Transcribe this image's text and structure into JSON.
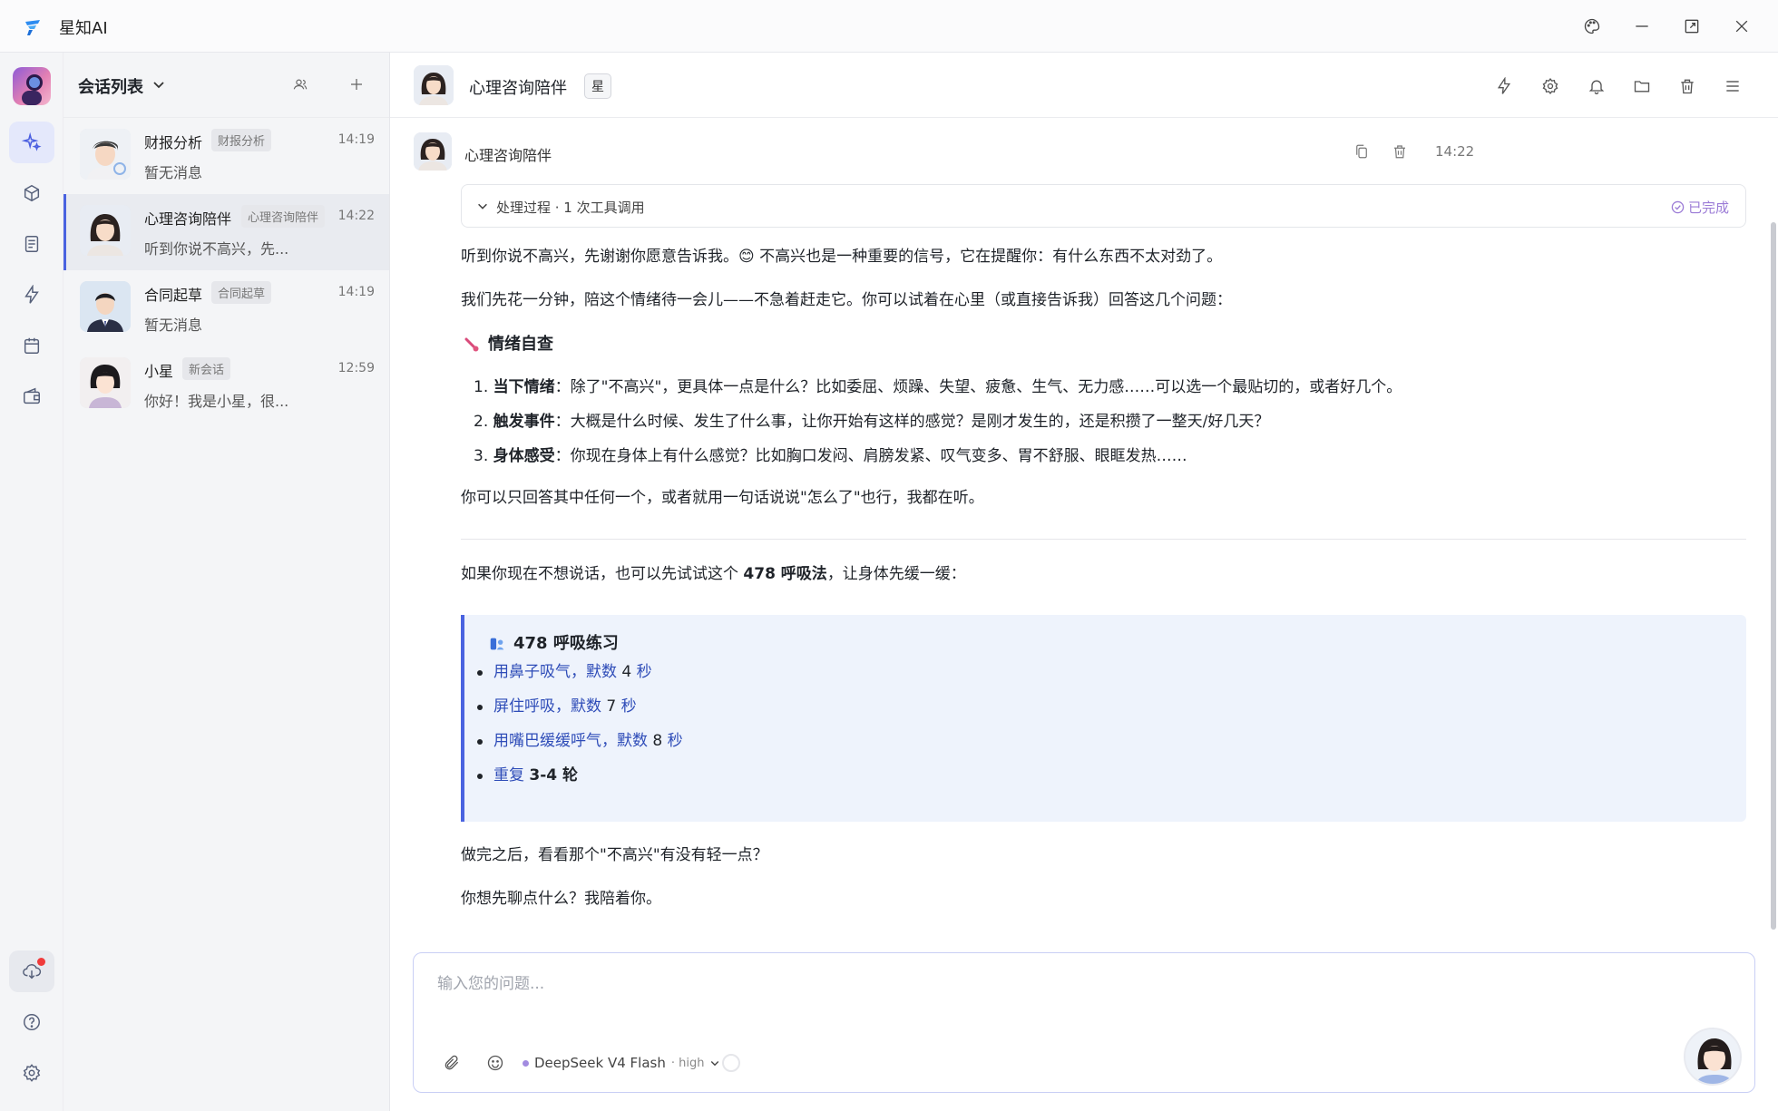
{
  "app": {
    "title": "星知AI"
  },
  "sessions": {
    "title": "会话列表",
    "items": [
      {
        "name": "财报分析",
        "tag": "财报分析",
        "time": "14:19",
        "preview": "暂无消息"
      },
      {
        "name": "心理咨询陪伴",
        "tag": "心理咨询陪伴",
        "time": "14:22",
        "preview": "听到你说不高兴，先..."
      },
      {
        "name": "合同起草",
        "tag": "合同起草",
        "time": "14:19",
        "preview": "暂无消息"
      },
      {
        "name": "小星",
        "tag": "新会话",
        "time": "12:59",
        "preview": "你好！我是小星，很..."
      }
    ]
  },
  "chat": {
    "title": "心理咨询陪伴",
    "badge": "星",
    "sender": "心理咨询陪伴",
    "time": "14:22",
    "process_label": "处理过程 · 1 次工具调用",
    "process_status": "已完成",
    "p1": "听到你说不高兴，先谢谢你愿意告诉我。😊 不高兴也是一种重要的信号，它在提醒你：有什么东西不太对劲了。",
    "p2": "我们先花一分钟，陪这个情绪待一会儿——不急着赶走它。你可以试着在心里（或直接告诉我）回答这几个问题：",
    "h_check": "情绪自查",
    "q": [
      {
        "n": "1.",
        "k": "当下情绪",
        "t": "：除了\"不高兴\"，更具体一点是什么？比如委屈、烦躁、失望、疲惫、生气、无力感……可以选一个最贴切的，或者好几个。"
      },
      {
        "n": "2.",
        "k": "触发事件",
        "t": "：大概是什么时候、发生了什么事，让你开始有这样的感觉？是刚才发生的，还是积攒了一整天/好几天？"
      },
      {
        "n": "3.",
        "k": "身体感受",
        "t": "：你现在身体上有什么感觉？比如胸口发闷、肩膀发紧、叹气变多、胃不舒服、眼眶发热……"
      }
    ],
    "p3": "你可以只回答其中任何一个，或者就用一句话说说\"怎么了\"也行，我都在听。",
    "p4_a": "如果你现在不想说话，也可以先试试这个 ",
    "p4_b": "478 呼吸法",
    "p4_c": "，让身体先缓一缓：",
    "breath_title": "478 呼吸练习",
    "breath": [
      {
        "a": "用鼻子吸气，默数 ",
        "n": "4",
        "b": " 秒"
      },
      {
        "a": "屏住呼吸，默数 ",
        "n": "7",
        "b": " 秒"
      },
      {
        "a": "用嘴巴缓缓呼气，默数 ",
        "n": "8",
        "b": " 秒"
      },
      {
        "a": "重复 ",
        "n": "3-4 轮",
        "b": ""
      }
    ],
    "p5": "做完之后，看看那个\"不高兴\"有没有轻一点？",
    "p6": "你想先聊点什么？我陪着你。"
  },
  "input": {
    "placeholder": "输入您的问题...",
    "model": "DeepSeek V4 Flash",
    "model_level": "· high"
  },
  "colors": {
    "accent": "#4a63e0",
    "done": "#9b7bd6",
    "quote_bg": "#eef3fc",
    "link": "#2e4cb8"
  }
}
